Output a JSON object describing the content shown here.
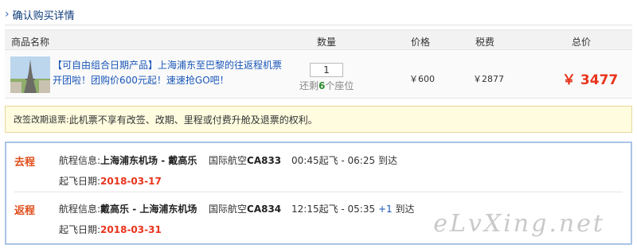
{
  "section": {
    "title": "确认购买详情"
  },
  "table": {
    "headers": [
      "商品名称",
      "数量",
      "价格",
      "税费",
      "总价"
    ],
    "product": {
      "name": "【可自由组合日期产品】上海浦东至巴黎的往返程机票开团啦！团购价600元起！速速抢GO吧！",
      "quantity": "1",
      "remaining_prefix": "还剩",
      "remaining_count": "6",
      "remaining_suffix": "个座位",
      "price": "￥600",
      "tax": "￥2877",
      "total": "￥ 3477"
    }
  },
  "notice": {
    "label": "改签改期退票:",
    "text": " 此机票不享有改签、改期、里程或付费升舱及退票的权利。"
  },
  "flights": [
    {
      "direction": "去程",
      "route_label": "航程信息:",
      "route": "上海浦东机场 - 戴高乐",
      "airline_prefix": "国际航空",
      "flight_no": "CA833",
      "times": "00:45起飞 - 06:25 到达",
      "plus_day": "",
      "date_label": "起飞日期:",
      "date": "2018-03-17"
    },
    {
      "direction": "返程",
      "route_label": "航程信息:",
      "route": "戴高乐 - 上海浦东机场",
      "airline_prefix": "国际航空",
      "flight_no": "CA834",
      "times": "12:15起飞 - 05:35 ",
      "plus_day": "+1",
      "times_suffix": " 到达",
      "date_label": "起飞日期:",
      "date": "2018-03-31"
    }
  ],
  "watermark": "eLvXing.net",
  "colors": {
    "link": "#1a56b8",
    "accent_red": "#e8341c",
    "direction": "#e04e1a",
    "notice_bg": "#fffce0",
    "box_border": "#a9c4e6"
  }
}
